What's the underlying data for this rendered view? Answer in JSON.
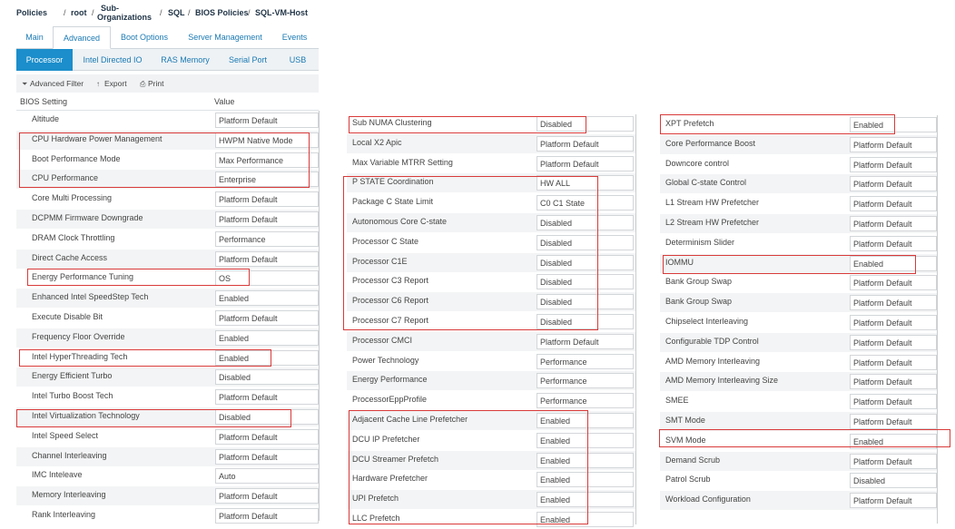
{
  "breadcrumb": {
    "policies": "Policies",
    "root": "root",
    "sub1": "Sub-",
    "sub2": "Organizations",
    "sql": "SQL",
    "bios": "BIOS Policies",
    "host": "SQL-VM-Host",
    "sep": "/"
  },
  "tabs": [
    "Main",
    "Advanced",
    "Boot Options",
    "Server Management",
    "Events"
  ],
  "active_tab": "Advanced",
  "subtabs": [
    "Processor",
    "Intel Directed IO",
    "RAS Memory",
    "Serial Port",
    "USB"
  ],
  "active_subtab": "Processor",
  "toolbar": {
    "filter": "Advanced Filter",
    "export": "Export",
    "print": "Print",
    "filter_icon": "funnel-icon",
    "export_icon": "upload-arrow-icon",
    "print_icon": "printer-icon"
  },
  "table_headers": {
    "setting": "BIOS Setting",
    "value": "Value"
  },
  "colors": {
    "accent": "#1b8ecb",
    "link": "#1b7ab3",
    "highlight": "#d93a3a"
  },
  "panel1": [
    {
      "label": "Altitude",
      "value": "Platform Default"
    },
    {
      "label": "CPU Hardware Power Management",
      "value": "HWPM Native Mode"
    },
    {
      "label": "Boot Performance Mode",
      "value": "Max Performance"
    },
    {
      "label": "CPU Performance",
      "value": "Enterprise"
    },
    {
      "label": "Core Multi Processing",
      "value": "Platform Default"
    },
    {
      "label": "DCPMM Firmware Downgrade",
      "value": "Platform Default"
    },
    {
      "label": "DRAM Clock Throttling",
      "value": "Performance"
    },
    {
      "label": "Direct Cache Access",
      "value": "Platform Default"
    },
    {
      "label": "Energy Performance Tuning",
      "value": "OS"
    },
    {
      "label": "Enhanced Intel SpeedStep Tech",
      "value": "Enabled"
    },
    {
      "label": "Execute Disable Bit",
      "value": "Platform Default"
    },
    {
      "label": "Frequency Floor Override",
      "value": "Enabled"
    },
    {
      "label": "Intel HyperThreading Tech",
      "value": "Enabled"
    },
    {
      "label": "Energy Efficient Turbo",
      "value": "Disabled"
    },
    {
      "label": "Intel Turbo Boost Tech",
      "value": "Platform Default"
    },
    {
      "label": "Intel Virtualization Technology",
      "value": "Disabled"
    },
    {
      "label": "Intel Speed Select",
      "value": "Platform Default"
    },
    {
      "label": "Channel Interleaving",
      "value": "Platform Default"
    },
    {
      "label": "IMC Inteleave",
      "value": "Auto"
    },
    {
      "label": "Memory Interleaving",
      "value": "Platform Default"
    },
    {
      "label": "Rank Interleaving",
      "value": "Platform Default"
    }
  ],
  "panel2": [
    {
      "label": "Sub NUMA Clustering",
      "value": "Disabled"
    },
    {
      "label": "Local X2 Apic",
      "value": "Platform Default"
    },
    {
      "label": "Max Variable MTRR Setting",
      "value": "Platform Default"
    },
    {
      "label": "P STATE Coordination",
      "value": "HW ALL"
    },
    {
      "label": "Package C State Limit",
      "value": "C0 C1 State"
    },
    {
      "label": "Autonomous Core C-state",
      "value": "Disabled"
    },
    {
      "label": "Processor C State",
      "value": "Disabled"
    },
    {
      "label": "Processor C1E",
      "value": "Disabled"
    },
    {
      "label": "Processor C3 Report",
      "value": "Disabled"
    },
    {
      "label": "Processor C6 Report",
      "value": "Disabled"
    },
    {
      "label": "Processor C7 Report",
      "value": "Disabled"
    },
    {
      "label": "Processor CMCI",
      "value": "Platform Default"
    },
    {
      "label": "Power Technology",
      "value": "Performance"
    },
    {
      "label": "Energy Performance",
      "value": "Performance"
    },
    {
      "label": "ProcessorEppProfile",
      "value": "Performance"
    },
    {
      "label": "Adjacent Cache Line Prefetcher",
      "value": "Enabled"
    },
    {
      "label": "DCU IP Prefetcher",
      "value": "Enabled"
    },
    {
      "label": "DCU Streamer Prefetch",
      "value": "Enabled"
    },
    {
      "label": "Hardware Prefetcher",
      "value": "Enabled"
    },
    {
      "label": "UPI Prefetch",
      "value": "Enabled"
    },
    {
      "label": "LLC Prefetch",
      "value": "Enabled"
    }
  ],
  "panel3": [
    {
      "label": "XPT Prefetch",
      "value": "Enabled"
    },
    {
      "label": "Core Performance Boost",
      "value": "Platform Default"
    },
    {
      "label": "Downcore control",
      "value": "Platform Default"
    },
    {
      "label": "Global C-state Control",
      "value": "Platform Default"
    },
    {
      "label": "L1 Stream HW Prefetcher",
      "value": "Platform Default"
    },
    {
      "label": "L2 Stream HW Prefetcher",
      "value": "Platform Default"
    },
    {
      "label": "Determinism Slider",
      "value": "Platform Default"
    },
    {
      "label": "IOMMU",
      "value": "Enabled"
    },
    {
      "label": "Bank Group Swap",
      "value": "Platform Default"
    },
    {
      "label": "Bank Group Swap",
      "value": "Platform Default"
    },
    {
      "label": "Chipselect Interleaving",
      "value": "Platform Default"
    },
    {
      "label": "Configurable TDP Control",
      "value": "Platform Default"
    },
    {
      "label": "AMD Memory Interleaving",
      "value": "Platform Default"
    },
    {
      "label": "AMD Memory Interleaving Size",
      "value": "Platform Default"
    },
    {
      "label": "SMEE",
      "value": "Platform Default"
    },
    {
      "label": "SMT Mode",
      "value": "Platform Default"
    },
    {
      "label": "SVM Mode",
      "value": "Enabled"
    },
    {
      "label": "Demand Scrub",
      "value": "Platform Default"
    },
    {
      "label": "Patrol Scrub",
      "value": "Disabled"
    },
    {
      "label": "Workload Configuration",
      "value": "Platform Default"
    }
  ]
}
